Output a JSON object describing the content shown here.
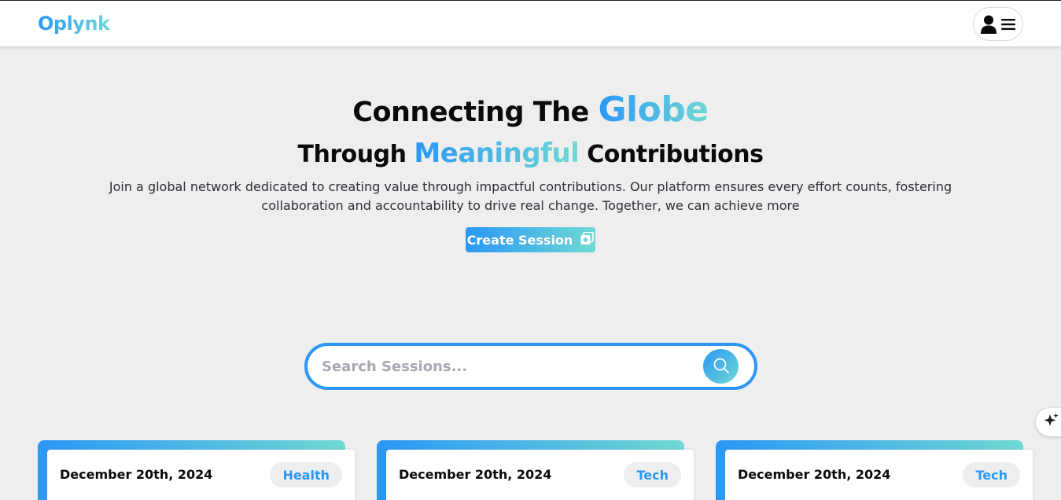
{
  "app": {
    "brand": "Oplynk",
    "colors": {
      "accent_start": "#2b97f6",
      "accent_end": "#6fd9d3",
      "background": "#eeeeee"
    }
  },
  "header": {
    "user_icon": "user-icon",
    "menu_icon": "hamburger-menu-icon"
  },
  "hero": {
    "line1_prefix": "Connecting The",
    "line1_highlight": "Globe",
    "line2_prefix": "Through",
    "line2_highlight": "Meaningful",
    "line2_suffix": "Contributions",
    "description": "Join a global network dedicated to creating value through impactful contributions. Our platform ensures every effort counts, fostering collaboration and accountability to drive real change. Together, we can achieve more",
    "create_button_label": "Create Session",
    "create_button_icon": "add-copy-icon"
  },
  "search": {
    "placeholder": "Search Sessions...",
    "value": "",
    "icon": "search-icon"
  },
  "floating": {
    "icon": "sparkle-icon"
  },
  "sessions": [
    {
      "date": "December 20th, 2024",
      "category": "Health"
    },
    {
      "date": "December 20th, 2024",
      "category": "Tech"
    },
    {
      "date": "December 20th, 2024",
      "category": "Tech"
    }
  ]
}
